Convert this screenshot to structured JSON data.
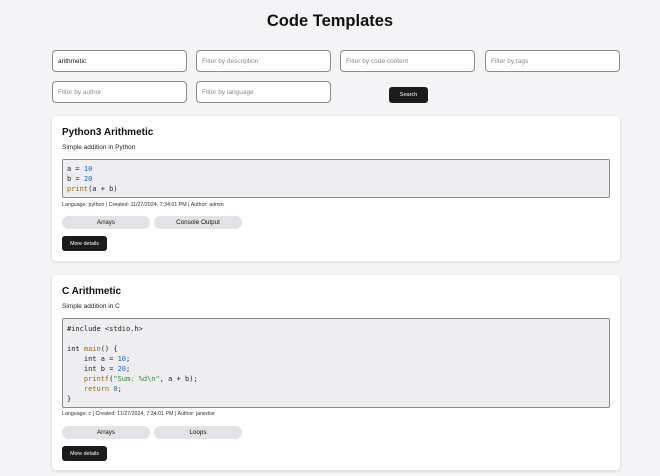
{
  "page": {
    "title": "Code Templates"
  },
  "filters": {
    "name": {
      "value": "arithmetic",
      "placeholder": ""
    },
    "description": {
      "value": "",
      "placeholder": "Filter by description"
    },
    "code_content": {
      "value": "",
      "placeholder": "Filter by code content"
    },
    "tags": {
      "value": "",
      "placeholder": "Filter by tags"
    },
    "author": {
      "value": "",
      "placeholder": "Filter by author"
    },
    "language": {
      "value": "",
      "placeholder": "Filter by language"
    },
    "search_label": "Search"
  },
  "colors": {
    "keyword": "#9a6a00",
    "number": "#1767c2",
    "string": "#2a8a2a",
    "function": "#9a6a00",
    "default": "#222222"
  },
  "templates": [
    {
      "title": "Python3 Arithmetic",
      "description": "Simple addition in Python",
      "code_lines": [
        [
          [
            "a = ",
            "default"
          ],
          [
            "10",
            "number"
          ]
        ],
        [
          [
            "b = ",
            "default"
          ],
          [
            "20",
            "number"
          ]
        ],
        [
          [
            "print",
            "function"
          ],
          [
            "(a + b)",
            "default"
          ]
        ]
      ],
      "meta": "Language: python | Created: 11/27/2024, 7:34:01 PM | Author: admin",
      "tags": [
        "Arrays",
        "Console Output"
      ],
      "details_label": "More details"
    },
    {
      "title": "C Arithmetic",
      "description": "Simple addition in C",
      "code_lines": [
        [
          [
            "#include <stdio.h>",
            "default"
          ]
        ],
        [
          [
            "",
            "default"
          ]
        ],
        [
          [
            "int ",
            "default"
          ],
          [
            "main",
            "function"
          ],
          [
            "() {",
            "default"
          ]
        ],
        [
          [
            "    int a = ",
            "default"
          ],
          [
            "10",
            "number"
          ],
          [
            ";",
            "default"
          ]
        ],
        [
          [
            "    int b = ",
            "default"
          ],
          [
            "20",
            "number"
          ],
          [
            ";",
            "default"
          ]
        ],
        [
          [
            "    ",
            "default"
          ],
          [
            "printf",
            "function"
          ],
          [
            "(",
            "default"
          ],
          [
            "\"Sum: %d\\n\"",
            "string"
          ],
          [
            ", a + b);",
            "default"
          ]
        ],
        [
          [
            "    ",
            "default"
          ],
          [
            "return",
            "keyword"
          ],
          [
            " ",
            "default"
          ],
          [
            "0",
            "number"
          ],
          [
            ";",
            "default"
          ]
        ],
        [
          [
            "}",
            "default"
          ]
        ]
      ],
      "meta": "Language: c | Created: 11/27/2024, 7:34:01 PM | Author: janedoe",
      "tags": [
        "Arrays",
        "Loops"
      ],
      "details_label": "More details"
    }
  ]
}
